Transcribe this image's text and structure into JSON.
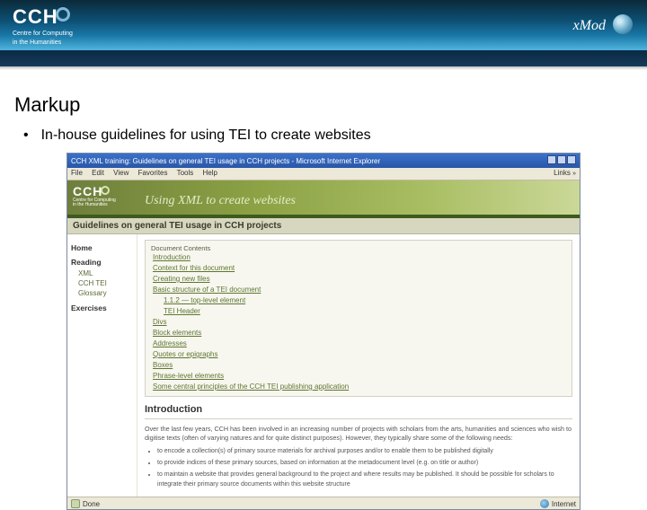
{
  "slide_header": {
    "logo_main": "CCH",
    "logo_sub_line1": "Centre for Computing",
    "logo_sub_line2": "in the Humanities",
    "right_brand": "xMod"
  },
  "slide": {
    "title": "Markup",
    "bullet": "In-house guidelines for using TEI to create websites"
  },
  "browser": {
    "title": "CCH XML training: Guidelines on general TEI usage in CCH projects - Microsoft Internet Explorer",
    "menu": {
      "items": [
        "File",
        "Edit",
        "View",
        "Favorites",
        "Tools",
        "Help"
      ],
      "links_label": "Links"
    },
    "status_left": "Done",
    "status_right": "Internet"
  },
  "page": {
    "logo_main": "CCH",
    "logo_sub_line1": "Centre for Computing",
    "logo_sub_line2": "in the Humanities",
    "banner_title": "Using XML to create websites",
    "heading": "Guidelines on general TEI usage in CCH projects",
    "sidebar": {
      "home": "Home",
      "reading_head": "Reading",
      "reading_items": [
        "XML",
        "CCH TEI",
        "Glossary"
      ],
      "exercises_head": "Exercises"
    },
    "toc": {
      "header": "Document Contents",
      "items": [
        {
          "label": "Introduction",
          "indent": 0
        },
        {
          "label": "Context for this document",
          "indent": 0
        },
        {
          "label": "Creating new files",
          "indent": 0
        },
        {
          "label": "Basic structure of a TEI document",
          "indent": 0
        },
        {
          "label": "1.1.2 — top-level element",
          "indent": 1
        },
        {
          "label": "TEI Header",
          "indent": 1
        },
        {
          "label": "Divs",
          "indent": 0
        },
        {
          "label": "Block elements",
          "indent": 0
        },
        {
          "label": "Addresses",
          "indent": 0
        },
        {
          "label": "Quotes or epigraphs",
          "indent": 0
        },
        {
          "label": "Boxes",
          "indent": 0
        },
        {
          "label": "Phrase-level elements",
          "indent": 0
        },
        {
          "label": "Some central principles of the CCH TEI publishing application",
          "indent": 0
        }
      ]
    },
    "intro": {
      "title": "Introduction",
      "para": "Over the last few years, CCH has been involved in an increasing number of projects with scholars from the arts, humanities and sciences who wish to digitise texts (often of varying natures and for quite distinct purposes). However, they typically share some of the following needs:",
      "bullets": [
        "to encode a collection(s) of primary source materials for archival purposes and/or to enable them to be published digitally",
        "to provide indices of these primary sources, based on information at the metadocument level (e.g. on title or author)",
        "to maintain a website that provides general background to the project and where results may be published. It should be possible for scholars to integrate their primary source documents within this website structure"
      ]
    }
  }
}
